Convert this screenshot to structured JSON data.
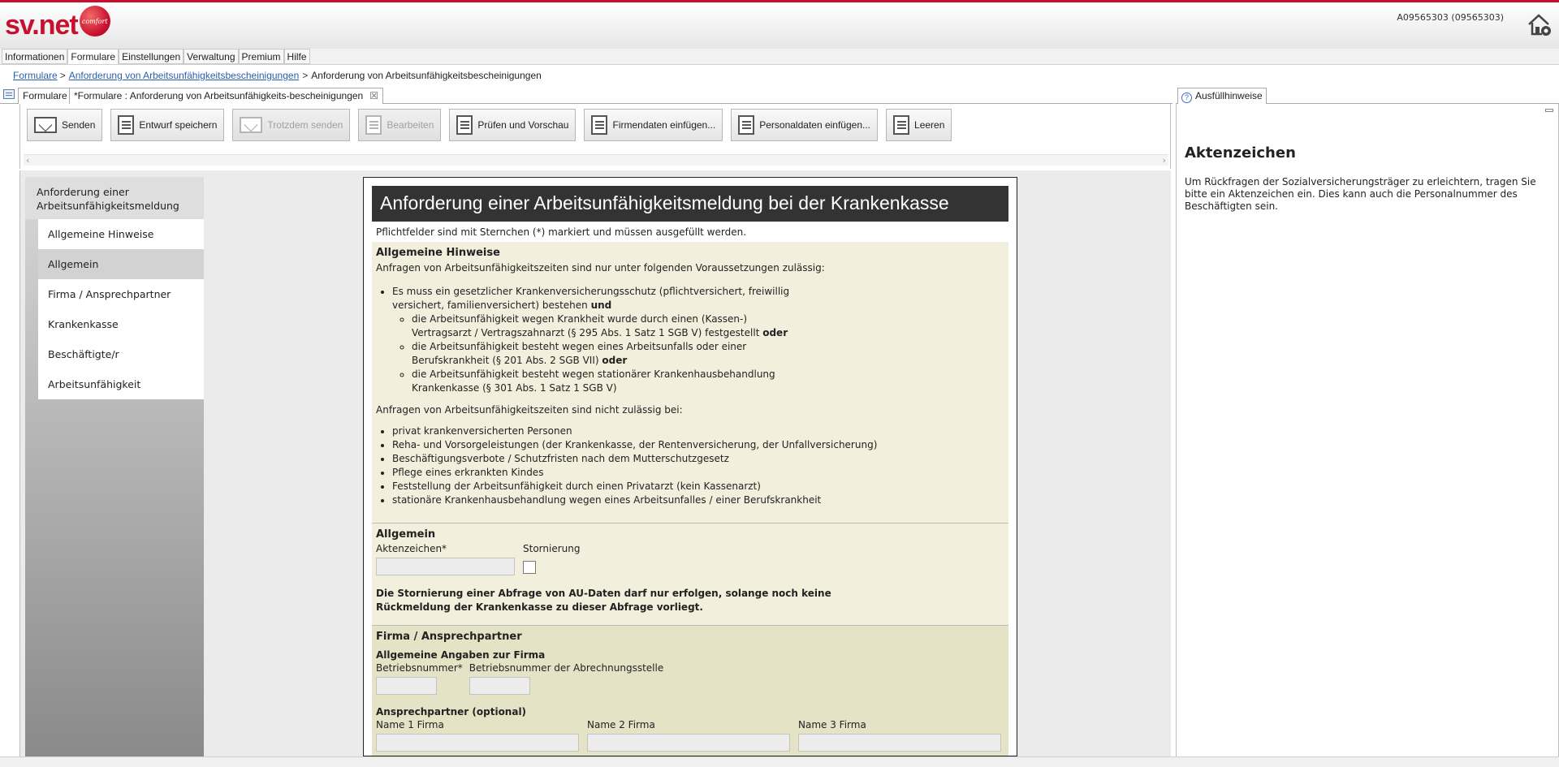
{
  "app": {
    "logo_text": "sv.net",
    "logo_badge": "comfort",
    "user_id": "A09565303 (09565303)"
  },
  "menu": [
    "Informationen",
    "Formulare",
    "Einstellungen",
    "Verwaltung",
    "Premium",
    "Hilfe"
  ],
  "breadcrumb": {
    "item1": "Formulare",
    "item2": "Anforderung von Arbeitsunfähigkeitsbescheinigungen",
    "current": "Anforderung von Arbeitsunfähigkeitsbescheinigungen",
    "sep": ">"
  },
  "editor_tabs": {
    "tab1": "Formulare",
    "tab2": "*Formulare : Anforderung von Arbeitsunfähigkeits-bescheinigungen",
    "close": "☒"
  },
  "toolbar": {
    "send": "Senden",
    "save_draft": "Entwurf speichern",
    "send_anyway": "Trotzdem senden",
    "edit": "Bearbeiten",
    "check_preview": "Prüfen und Vorschau",
    "insert_company": "Firmendaten einfügen...",
    "insert_personal": "Personaldaten einfügen...",
    "clear": "Leeren"
  },
  "nav": {
    "heading": "Anforderung einer Arbeitsunfähigkeitsmeldung",
    "items": [
      "Allgemeine Hinweise",
      "Allgemein",
      "Firma / Ansprechpartner",
      "Krankenkasse",
      "Beschäftigte/r",
      "Arbeitsunfähigkeit"
    ]
  },
  "doc": {
    "title": "Anforderung einer Arbeitsunfähigkeitsmeldung bei der Krankenkasse",
    "note": "Pflichtfelder sind mit Sternchen (*) markiert und müssen ausgefüllt werden.",
    "hinweise": {
      "title": "Allgemeine Hinweise",
      "intro": "Anfragen von Arbeitsunfähigkeitszeiten sind nur unter folgenden Voraussetzungen zulässig:",
      "b1_line1": "Es muss ein gesetzlicher Krankenversicherungsschutz (pflichtversichert, freiwillig",
      "b1_line2": "versichert, familienversichert) bestehen ",
      "und": "und",
      "c1_line1": "die Arbeitsunfähigkeit wegen Krankheit wurde durch einen (Kassen-)",
      "c1_line2": "Vertragsarzt / Vertragszahnarzt (§ 295 Abs. 1 Satz 1 SGB V) festgestellt ",
      "oder1": "oder",
      "c2_line1": "die Arbeitsunfähigkeit besteht wegen eines Arbeitsunfalls oder einer",
      "c2_line2": "Berufskrankheit (§ 201 Abs. 2 SGB VII) ",
      "oder2": "oder",
      "c3_line1": "die Arbeitsunfähigkeit besteht wegen stationärer Krankenhausbehandlung",
      "c3_line2": "Krankenkasse (§ 301 Abs. 1 Satz 1 SGB V)",
      "intro2": "Anfragen von Arbeitsunfähigkeitszeiten sind nicht zulässig bei:",
      "list2": [
        "privat krankenversicherten Personen",
        "Reha- und Vorsorgeleistungen (der Krankenkasse, der Rentenversicherung, der Unfallversicherung)",
        "Beschäftigungsverbote / Schutzfristen nach dem Mutterschutzgesetz",
        "Pflege eines erkrankten Kindes",
        "Feststellung der Arbeitsunfähigkeit durch einen Privatarzt (kein Kassenarzt)",
        "stationäre Krankenhausbehandlung wegen eines Arbeitsunfalles / einer Berufskrankheit"
      ]
    },
    "allgemein": {
      "title": "Allgemein",
      "aktenzeichen_label": "Aktenzeichen*",
      "aktenzeichen_value": "",
      "stornierung_label": "Stornierung",
      "stornierung_checked": false,
      "note_line1": "Die Stornierung einer Abfrage von AU-Daten darf nur erfolgen, solange noch keine",
      "note_line2": "Rückmeldung der Krankenkasse zu dieser Abfrage vorliegt."
    },
    "firma": {
      "title": "Firma / Ansprechpartner",
      "sub1": "Allgemeine Angaben zur Firma",
      "betriebsnummer_label": "Betriebsnummer*",
      "betriebsnummer_abr_label": "Betriebsnummer der Abrechnungsstelle",
      "sub2": "Ansprechpartner (optional)",
      "name1_label": "Name 1 Firma",
      "name2_label": "Name 2 Firma",
      "name3_label": "Name 3 Firma"
    }
  },
  "help": {
    "tab_label": "Ausfüllhinweise",
    "title": "Aktenzeichen",
    "text": "Um Rückfragen der Sozialversicherungsträger zu erleichtern, tragen Sie bitte ein Aktenzeichen ein. Dies kann auch die Personalnummer des Beschäftigten sein."
  },
  "colors": {
    "brand": "#c8102e",
    "doc_title_bg": "#333333",
    "section_bg": "#f2efdc",
    "section_bg_dark": "#e5e3c6"
  }
}
